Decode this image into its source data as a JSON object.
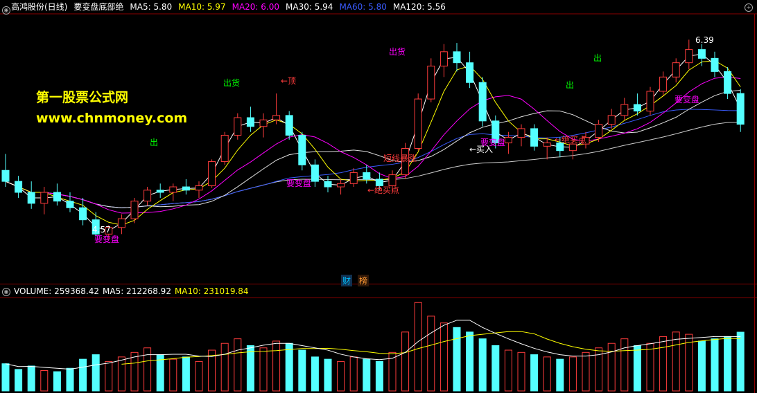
{
  "header": {
    "stock": "高鸿股份(日线)",
    "indicator": "要变盘底部绝",
    "ma": [
      {
        "label": "MA5: 5.80",
        "color": "#ffffff"
      },
      {
        "label": "MA10: 5.97",
        "color": "#ffff00"
      },
      {
        "label": "MA20: 6.00",
        "color": "#ff00ff"
      },
      {
        "label": "MA30: 5.94",
        "color": "#ffffff"
      },
      {
        "label": "MA60: 5.80",
        "color": "#3a5cff"
      },
      {
        "label": "MA120: 5.56",
        "color": "#ffffff"
      }
    ]
  },
  "watermark": {
    "line1": "第一股票公式网",
    "line2": "www.chnmoney.com"
  },
  "annotations": {
    "chu": "出",
    "chuhuo": "出货",
    "ding": "←顶",
    "yaobianpan": "要变盘",
    "duanxianbaozhang": "短线暴涨",
    "juemaidian": "←绝买点",
    "mairu": "←买入",
    "low_price": "4.57",
    "high_price": "6.39"
  },
  "tabs": [
    "财",
    "榜"
  ],
  "volume_header": [
    {
      "label": "VOLUME: 259368.42",
      "color": "#ffffff"
    },
    {
      "label": "MA5: 212268.92",
      "color": "#ffffff"
    },
    {
      "label": "MA10: 231019.84",
      "color": "#ffff00"
    }
  ],
  "icons": {
    "left": "gear-icon",
    "right": "zoom-icon"
  },
  "chart_data": {
    "type": "candlestick",
    "ylim": [
      4.2,
      6.6
    ],
    "colors": {
      "up": "#ff3c3c",
      "down": "#54ffff",
      "ma5": "#ffffff",
      "ma10": "#ffff00",
      "ma20": "#ff00ff",
      "ma30": "#e0e0e0",
      "ma60": "#3a5cff",
      "ma120": "#cccccc",
      "vol_ma10": "#ffff00"
    },
    "candles": [
      [
        5.2,
        5.35,
        5.05,
        5.1
      ],
      [
        5.1,
        5.15,
        4.95,
        5.0
      ],
      [
        5.0,
        5.1,
        4.85,
        4.9
      ],
      [
        4.9,
        5.05,
        4.8,
        5.0
      ],
      [
        5.0,
        5.08,
        4.88,
        4.92
      ],
      [
        4.92,
        5.0,
        4.82,
        4.86
      ],
      [
        4.86,
        4.95,
        4.7,
        4.75
      ],
      [
        4.75,
        4.82,
        4.6,
        4.62
      ],
      [
        4.62,
        4.7,
        4.57,
        4.68
      ],
      [
        4.68,
        4.8,
        4.62,
        4.76
      ],
      [
        4.76,
        4.95,
        4.72,
        4.92
      ],
      [
        4.92,
        5.05,
        4.88,
        5.02
      ],
      [
        5.02,
        5.08,
        4.95,
        5.0
      ],
      [
        5.0,
        5.08,
        4.92,
        5.05
      ],
      [
        5.05,
        5.12,
        4.98,
        5.02
      ],
      [
        5.02,
        5.1,
        4.95,
        5.06
      ],
      [
        5.06,
        5.3,
        5.04,
        5.28
      ],
      [
        5.28,
        5.55,
        5.25,
        5.52
      ],
      [
        5.52,
        5.72,
        5.48,
        5.68
      ],
      [
        5.68,
        5.78,
        5.55,
        5.6
      ],
      [
        5.6,
        5.72,
        5.5,
        5.66
      ],
      [
        5.66,
        5.9,
        5.62,
        5.7
      ],
      [
        5.7,
        5.74,
        5.48,
        5.52
      ],
      [
        5.52,
        5.55,
        5.2,
        5.25
      ],
      [
        5.25,
        5.3,
        5.05,
        5.1
      ],
      [
        5.1,
        5.15,
        5.0,
        5.05
      ],
      [
        5.05,
        5.12,
        4.98,
        5.08
      ],
      [
        5.08,
        5.22,
        5.05,
        5.18
      ],
      [
        5.18,
        5.25,
        5.08,
        5.12
      ],
      [
        5.12,
        5.18,
        5.02,
        5.06
      ],
      [
        5.06,
        5.2,
        5.0,
        5.16
      ],
      [
        5.16,
        5.45,
        5.12,
        5.4
      ],
      [
        5.4,
        5.9,
        5.38,
        5.85
      ],
      [
        5.85,
        6.22,
        5.82,
        6.15
      ],
      [
        6.15,
        6.35,
        6.05,
        6.28
      ],
      [
        6.28,
        6.36,
        6.1,
        6.18
      ],
      [
        6.18,
        6.28,
        5.95,
        6.0
      ],
      [
        6.0,
        6.05,
        5.6,
        5.65
      ],
      [
        5.65,
        5.7,
        5.4,
        5.45
      ],
      [
        5.45,
        5.55,
        5.35,
        5.5
      ],
      [
        5.5,
        5.62,
        5.42,
        5.58
      ],
      [
        5.58,
        5.62,
        5.38,
        5.42
      ],
      [
        5.42,
        5.5,
        5.3,
        5.45
      ],
      [
        5.45,
        5.5,
        5.32,
        5.38
      ],
      [
        5.38,
        5.48,
        5.3,
        5.44
      ],
      [
        5.44,
        5.55,
        5.4,
        5.5
      ],
      [
        5.5,
        5.66,
        5.46,
        5.62
      ],
      [
        5.62,
        5.76,
        5.58,
        5.7
      ],
      [
        5.7,
        5.86,
        5.66,
        5.8
      ],
      [
        5.8,
        5.9,
        5.7,
        5.74
      ],
      [
        5.74,
        5.96,
        5.7,
        5.92
      ],
      [
        5.92,
        6.1,
        5.88,
        6.05
      ],
      [
        6.05,
        6.22,
        6.0,
        6.18
      ],
      [
        6.18,
        6.39,
        6.12,
        6.3
      ],
      [
        6.3,
        6.35,
        6.15,
        6.22
      ],
      [
        6.22,
        6.28,
        6.05,
        6.1
      ],
      [
        6.1,
        6.14,
        5.85,
        5.9
      ],
      [
        5.9,
        5.94,
        5.55,
        5.62
      ]
    ],
    "volume": {
      "ylim": [
        0,
        400000
      ],
      "values": [
        120000,
        95000,
        110000,
        90000,
        85000,
        100000,
        140000,
        160000,
        130000,
        150000,
        170000,
        190000,
        160000,
        140000,
        150000,
        130000,
        180000,
        210000,
        230000,
        200000,
        190000,
        220000,
        210000,
        180000,
        150000,
        140000,
        130000,
        150000,
        140000,
        130000,
        170000,
        260000,
        390000,
        330000,
        300000,
        280000,
        260000,
        230000,
        200000,
        180000,
        170000,
        160000,
        150000,
        140000,
        150000,
        170000,
        190000,
        210000,
        230000,
        200000,
        210000,
        240000,
        260000,
        250000,
        220000,
        230000,
        240000,
        259368
      ],
      "ma10": [
        null,
        null,
        null,
        null,
        null,
        null,
        null,
        null,
        null,
        118000,
        123000,
        132500,
        137500,
        142500,
        149000,
        152000,
        156000,
        161000,
        168000,
        173000,
        175000,
        178000,
        183000,
        187000,
        187000,
        188000,
        184000,
        178000,
        173000,
        166000,
        164000,
        169000,
        187000,
        202000,
        218000,
        231000,
        244000,
        250000,
        256000,
        262000,
        262000,
        252000,
        229000,
        210000,
        195000,
        184000,
        177000,
        175000,
        178000,
        180000,
        184000,
        192000,
        203000,
        214000,
        221000,
        227000,
        232000,
        231020
      ]
    }
  }
}
